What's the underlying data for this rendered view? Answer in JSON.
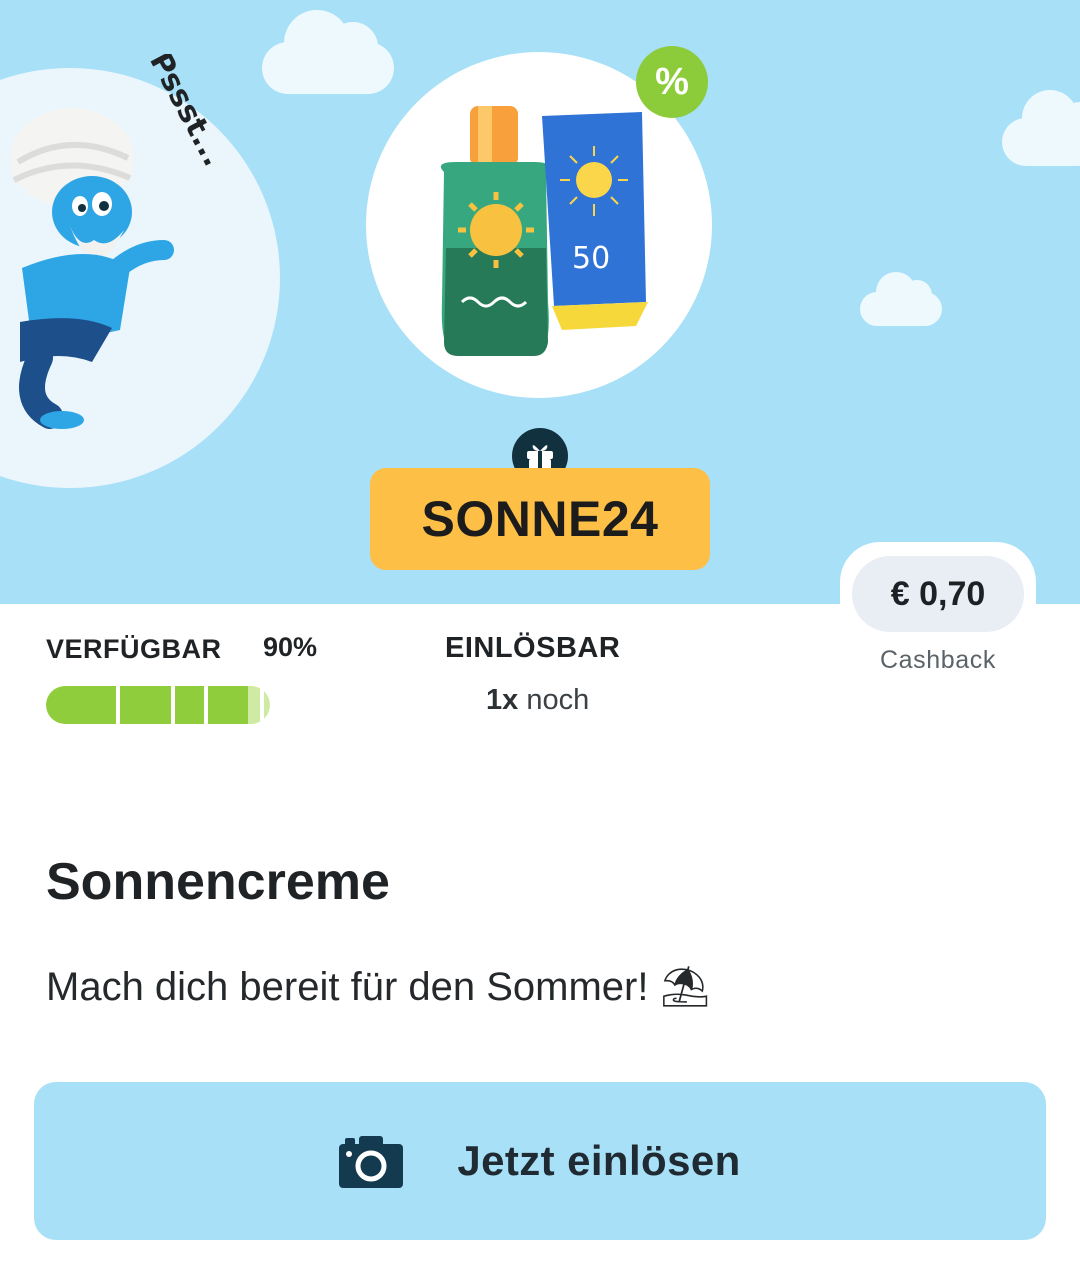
{
  "hero": {
    "whisper": "Pssst...",
    "sunscreen_spf": "50",
    "discount_badge": "%",
    "promo_code": "SONNE24"
  },
  "cashback": {
    "amount": "€ 0,70",
    "label": "Cashback"
  },
  "availability": {
    "label": "VERFÜGBAR",
    "percent_text": "90%",
    "percent": 90
  },
  "redeemable": {
    "label": "EINLÖSBAR",
    "count": "1x",
    "suffix": " noch"
  },
  "offer": {
    "title": "Sonnencreme",
    "description": "Mach dich bereit für den Sommer! ⛱"
  },
  "action": {
    "label": "Jetzt einlösen",
    "icon": "camera-icon"
  },
  "colors": {
    "banner_sky": "#a8e0f7",
    "promo_yellow": "#fdbf45",
    "progress_green": "#8fcd3c",
    "cta_background": "#a8e0f7"
  }
}
